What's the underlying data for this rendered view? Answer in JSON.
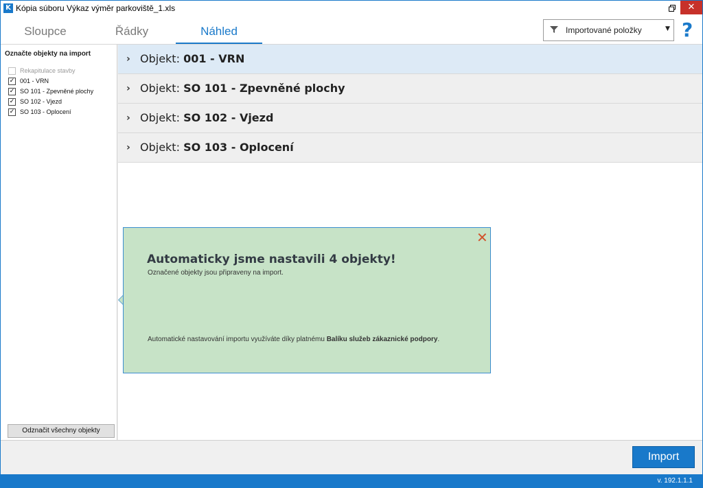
{
  "window": {
    "app_icon": "K",
    "title": "Kópia súboru Výkaz výměr parkoviště_1.xls",
    "restore_icon": "restore-icon",
    "close_icon": "close-icon"
  },
  "tabs": [
    {
      "label": "Sloupce",
      "active": false
    },
    {
      "label": "Řádky",
      "active": false
    },
    {
      "label": "Náhled",
      "active": true
    }
  ],
  "filter": {
    "icon": "filter-icon",
    "label": "Importované položky"
  },
  "help_icon": "?",
  "sidebar": {
    "title": "Označte objekty na import",
    "items": [
      {
        "label": "Rekapitulace stavby",
        "checked": false,
        "disabled": true
      },
      {
        "label": "001 - VRN",
        "checked": true,
        "disabled": false
      },
      {
        "label": "SO 101 - Zpevněné plochy",
        "checked": true,
        "disabled": false
      },
      {
        "label": "SO 102 - Vjezd",
        "checked": true,
        "disabled": false
      },
      {
        "label": "SO 103 - Oplocení",
        "checked": true,
        "disabled": false
      }
    ],
    "unmark_all_label": "Odznačit všechny objekty"
  },
  "objects": [
    {
      "prefix": "Objekt:",
      "name": "001 - VRN"
    },
    {
      "prefix": "Objekt:",
      "name": "SO 101 - Zpevněné plochy"
    },
    {
      "prefix": "Objekt:",
      "name": "SO 102 - Vjezd"
    },
    {
      "prefix": "Objekt:",
      "name": "SO 103 - Oplocení"
    }
  ],
  "popup": {
    "title": "Automaticky jsme nastavili 4 objekty!",
    "subtitle": "Označené objekty jsou připraveny na import.",
    "footer_text": "Automatické nastavování importu využíváte díky platnému",
    "footer_bold": "Balíku služeb zákaznické podpory",
    "footer_end": "."
  },
  "import_label": "Import",
  "version": "v. 192.1.1.1",
  "colors": {
    "accent": "#1979ca",
    "popup_bg": "#c7e3c7",
    "close_red": "#c7312a"
  }
}
